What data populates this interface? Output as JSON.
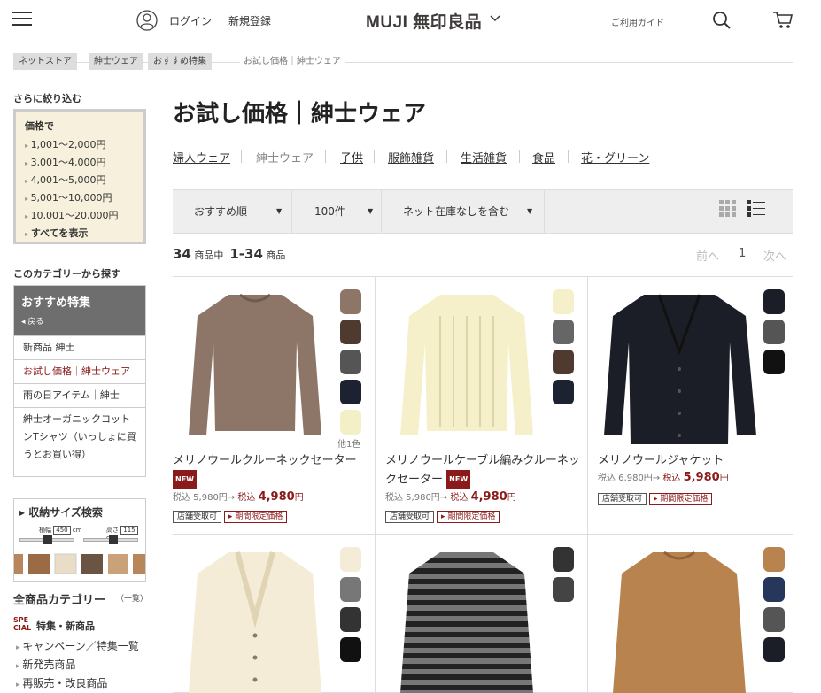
{
  "header": {
    "login": "ログイン",
    "signup": "新規登録",
    "logo": "MUJI 無印良品",
    "guide": "ご利用ガイド"
  },
  "breadcrumb": [
    "ネットストア",
    "紳士ウェア",
    "おすすめ特集",
    "お試し価格｜紳士ウェア"
  ],
  "sidebar": {
    "refine_title": "さらに絞り込む",
    "price_heading": "価格で",
    "price_items": [
      "1,001～2,000円",
      "3,001～4,000円",
      "4,001～5,000円",
      "5,001～10,000円",
      "10,001～20,000円",
      "すべてを表示"
    ],
    "category_title": "このカテゴリーから探す",
    "cat_head": "おすすめ特集",
    "cat_back": "◂ 戻る",
    "cat_items": [
      "新商品 紳士",
      "お試し価格｜紳士ウェア",
      "雨の日アイテム｜紳士",
      "紳士オーガニックコットンTシャツ（いっしょに買うとお買い得）"
    ],
    "size_title": "▸ 収納サイズ検索",
    "size_w_label": "横幅",
    "size_w": "450",
    "size_h_label": "高さ",
    "size_h": "115",
    "size_unit": "cm",
    "allcat_title": "全商品カテゴリー",
    "allcat_sub": "（一覧）",
    "special_icon": "SPE CIAL",
    "special_label": "特集・新商品",
    "links": [
      "キャンペーン／特集一覧",
      "新発売商品",
      "再販売・改良商品"
    ]
  },
  "main": {
    "title": "お試し価格｜紳士ウェア",
    "tabs": [
      "婦人ウェア",
      "紳士ウェア",
      "子供",
      "服飾雑貨",
      "生活雑貨",
      "食品",
      "花・グリーン"
    ],
    "sort": "おすすめ順",
    "per_page": "100件",
    "stock": "ネット在庫なしを含む",
    "count_total": "34",
    "count_total_unit": "商品中",
    "count_range": "1-34",
    "count_range_unit": "商品",
    "prev": "前へ",
    "page": "1",
    "next": "次へ"
  },
  "products": [
    {
      "name": "メリノウールクルーネックセーター",
      "new": "NEW",
      "was": "税込 5,980円→",
      "now_prefix": "税込",
      "now": "4,980",
      "yen": "円",
      "tag1": "店舗受取可",
      "tag2": "▸ 期間限定価格",
      "more": "他1色"
    },
    {
      "name": "メリノウールケーブル編みクルーネックセーター",
      "new": "NEW",
      "was": "税込 5,980円→",
      "now_prefix": "税込",
      "now": "4,980",
      "yen": "円",
      "tag1": "店舗受取可",
      "tag2": "▸ 期間限定価格"
    },
    {
      "name": "メリノウールジャケット",
      "was": "税込 6,980円→",
      "now_prefix": "税込",
      "now": "5,980",
      "yen": "円",
      "tag1": "店舗受取可",
      "tag2": "▸ 期間限定価格"
    }
  ],
  "colors": {
    "accent": "#8b1a1a",
    "sidebar_box": "#f7f0dc",
    "cat_head": "#6e6e6e"
  }
}
